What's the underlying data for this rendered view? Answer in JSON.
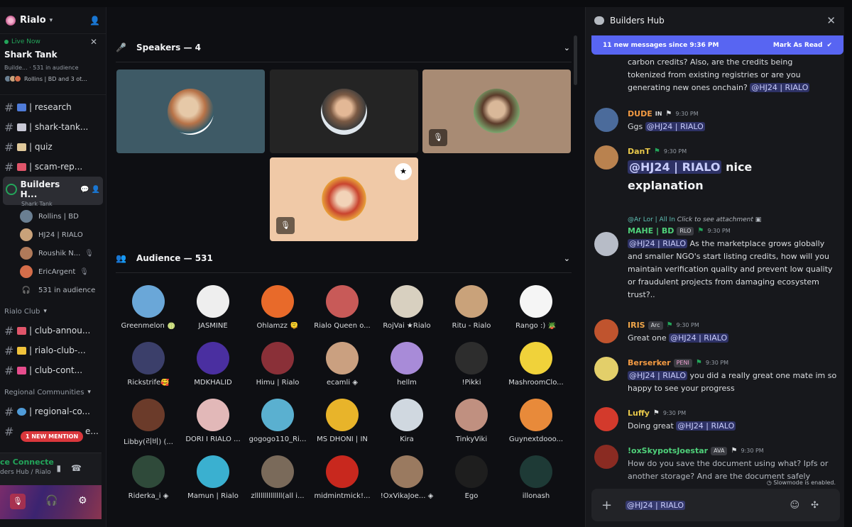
{
  "server": {
    "name": "Rialo"
  },
  "live": {
    "status": "Live Now",
    "title": "Shark Tank",
    "sub": "Builde... · 531 in audience",
    "speakers_text": "Rollins | BD and 3 ot..."
  },
  "channels_top": [
    {
      "label": "| research",
      "color": "#4f7bd8"
    },
    {
      "label": "| shark-tank...",
      "color": "#c9c9d6"
    },
    {
      "label": "| quiz",
      "color": "#e0c99b"
    },
    {
      "label": "| scam-rep...",
      "color": "#e0556a"
    }
  ],
  "active_channel": {
    "label": "Builders H...",
    "sub": "Shark Tank"
  },
  "voice_members": [
    {
      "name": "Rollins | BD",
      "muted": "",
      "color": "#6a7f92"
    },
    {
      "name": "HJ24 | RIALO",
      "muted": "",
      "color": "#c9a27a"
    },
    {
      "name": "Roushik N...",
      "muted": "🎙",
      "color": "#b07a5a"
    },
    {
      "name": "EricArgent",
      "muted": "🎙",
      "color": "#d46d4a"
    },
    {
      "name": "531 in audience",
      "muted": "",
      "color": ""
    }
  ],
  "categories": {
    "club": "Rialo Club",
    "regional": "Regional Communities"
  },
  "channels_club": [
    {
      "label": "| club-annou...",
      "color": "#e0556a"
    },
    {
      "label": "| rialo-club-...",
      "color": "#f0c23b"
    },
    {
      "label": "| club-cont...",
      "color": "#e64c8c"
    }
  ],
  "channels_regional": [
    {
      "label": "| regional-co...",
      "color": "#4f9bd8"
    },
    {
      "label": "e...",
      "color": ""
    }
  ],
  "mention_pill": "1 NEW MENTION",
  "voice_connected": {
    "title": "ce Connecte",
    "sub": "ders Hub / Rialo"
  },
  "stage": {
    "speakers_label": "Speakers — 4",
    "audience_label": "Audience — 531"
  },
  "audience": [
    "Greenmelon 🍈",
    "JASMINE",
    "Ohlamzz 🫠",
    "Rialo Queen o...",
    "RojVai ★Rialo",
    "Ritu - Rialo",
    "Rango :) 🪴",
    "Rickstrife🥰",
    "MDKHALID",
    "Himu | Rialo",
    "ecamli ◈",
    "hellm",
    "!Pikki",
    "MashroomClo...",
    "Libby(리비) (...",
    "DORI I RIALO ...",
    "gogogo110_Ri...",
    "MS DHONI | IN",
    "Kira",
    "TinkyViki",
    "Guynextdooo...",
    "Riderka_i ◈",
    "Mamun | Rialo",
    "zllllllllllllll(all i...",
    "midmintmick!...",
    "!OxVikaJoe... ◈",
    "Ego",
    "illonash"
  ],
  "chat": {
    "title": "Builders Hub",
    "new_bar": "11 new messages since 9:36 PM",
    "mark_read": "Mark As Read",
    "slowmode": "Slowmode is enabled.",
    "composer_text": "@HJ24 | RIALO",
    "messages": {
      "m0": {
        "line1": "carbon credits? Also, are the credits being",
        "line2": "tokenized from existing registries or are you",
        "line3": "generating new ones onchain?",
        "mention": "@HJ24 | RIALO"
      },
      "m1": {
        "name": "DUDE",
        "tag": "IN",
        "time": "9:30 PM",
        "text": "Ggs",
        "mention": "@HJ24 | RIALO"
      },
      "m2": {
        "name": "DanT",
        "time": "9:30 PM",
        "mention": "@HJ24 | RIALO",
        "text": "nice",
        "text2": "explanation"
      },
      "m3": {
        "reply_user": "@Ar Lor | All In",
        "reply_text": "Click to see attachment",
        "name": "MAHE | BD",
        "tag": "RLO",
        "time": "9:30 PM",
        "mention": "@HJ24 | RIALO",
        "text": "As the marketplace grows globally and smaller NGO's start listing credits, how will you maintain verification quality and prevent low quality or fraudulent projects from damaging ecosystem trust?.."
      },
      "m4": {
        "name": "IRIS",
        "tag": "Arc",
        "time": "9:30 PM",
        "text": "Great one",
        "mention": "@HJ24 | RIALO"
      },
      "m5": {
        "name": "Berserker",
        "tag": "PENI",
        "time": "9:30 PM",
        "mention": "@HJ24 | RIALO",
        "text": "you did a really great one mate im so happy to see your progress"
      },
      "m6": {
        "name": "Luffy",
        "time": "9:30 PM",
        "text": "Doing great",
        "mention": "@HJ24 | RIALO"
      },
      "m7": {
        "name": "!oxSkypotsJoestar",
        "tag": "AVA",
        "time": "9:30 PM",
        "text": "How do you save the document using what? Ipfs or another storage? And are the document safely"
      }
    }
  },
  "colors": {
    "accent": "#5865f2",
    "online": "#23a55a",
    "mention_red": "#da373c"
  }
}
